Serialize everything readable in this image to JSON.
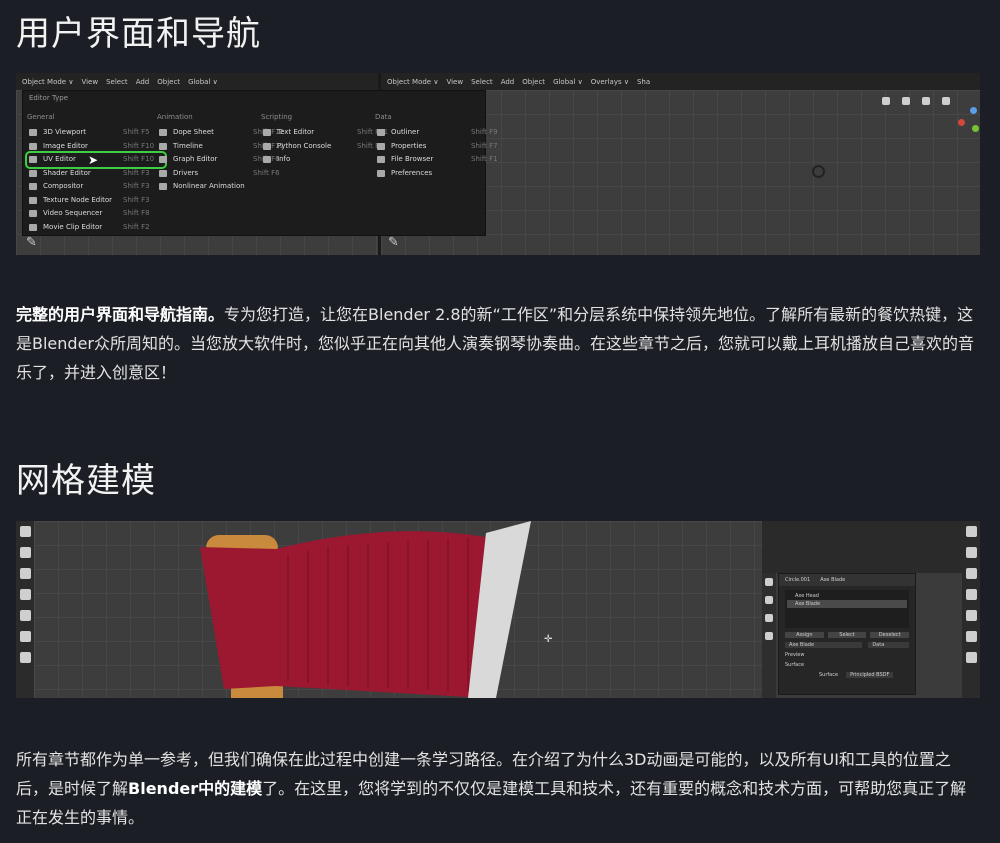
{
  "section1": {
    "title": "用户界面和导航",
    "para_lead": "完整的用户界面和导航指南。",
    "para_rest": "专为您打造，让您在Blender 2.8的新“工作区”和分层系统中保持领先地位。了解所有最新的餐饮热键，这是Blender众所周知的。当您放大软件时，您似乎正在向其他人演奏钢琴协奏曲。在这些章节之后，您就可以戴上耳机播放自己喜欢的音乐了，并进入创意区！"
  },
  "screenshot1": {
    "left_bar": [
      "Object Mode ∨",
      "View",
      "Select",
      "Add",
      "Object",
      "Global ∨"
    ],
    "right_bar": [
      "Object Mode ∨",
      "View",
      "Select",
      "Add",
      "Object",
      "Global ∨",
      "Overlays ∨",
      "Sha"
    ],
    "menu_title": "Editor Type",
    "columns": [
      {
        "header": "General",
        "items": [
          {
            "label": "3D Viewport",
            "shortcut": "Shift F5"
          },
          {
            "label": "Image Editor",
            "shortcut": "Shift F10"
          },
          {
            "label": "UV Editor",
            "shortcut": "Shift F10"
          },
          {
            "label": "Shader Editor",
            "shortcut": "Shift F3"
          },
          {
            "label": "Compositor",
            "shortcut": "Shift F3"
          },
          {
            "label": "Texture Node Editor",
            "shortcut": "Shift F3"
          },
          {
            "label": "Video Sequencer",
            "shortcut": "Shift F8"
          },
          {
            "label": "Movie Clip Editor",
            "shortcut": "Shift F2"
          }
        ]
      },
      {
        "header": "Animation",
        "items": [
          {
            "label": "Dope Sheet",
            "shortcut": "Shift F12"
          },
          {
            "label": "Timeline",
            "shortcut": "Shift F12"
          },
          {
            "label": "Graph Editor",
            "shortcut": "Shift F6"
          },
          {
            "label": "Drivers",
            "shortcut": "Shift F6"
          },
          {
            "label": "Nonlinear Animation",
            "shortcut": ""
          }
        ]
      },
      {
        "header": "Scripting",
        "items": [
          {
            "label": "Text Editor",
            "shortcut": "Shift F11"
          },
          {
            "label": "Python Console",
            "shortcut": "Shift F4"
          },
          {
            "label": "Info",
            "shortcut": ""
          }
        ]
      },
      {
        "header": "Data",
        "items": [
          {
            "label": "Outliner",
            "shortcut": "Shift F9"
          },
          {
            "label": "Properties",
            "shortcut": "Shift F7"
          },
          {
            "label": "File Browser",
            "shortcut": "Shift F1"
          },
          {
            "label": "Preferences",
            "shortcut": ""
          }
        ]
      }
    ],
    "highlight_color": "#3ecf3e"
  },
  "section2": {
    "title": "网格建模",
    "para_a": "所有章节都作为单一参考，但我们确保在此过程中创建一条学习路径。在介绍了为什么3D动画是可能的，以及所有UI和工具的位置之后，是时候了解",
    "para_bold": "Blender中的建模",
    "para_b": "了。在这里，您将学到的不仅仅是建模工具和技术，还有重要的概念和技术方面，可帮助您真正了解正在发生的事情。"
  },
  "screenshot2": {
    "panel_header": [
      "Circle.001",
      "Axe Blade"
    ],
    "panel_list": [
      "Axe Head",
      "Axe Blade"
    ],
    "panel_buttons": [
      "Assign",
      "Select",
      "Deselect"
    ],
    "panel_material": "Axe Blade",
    "panel_data": "Data",
    "panel_sections": [
      "Preview",
      "Surface"
    ],
    "panel_surface_label": "Surface",
    "panel_surface_value": "Principled BSDF",
    "blade_color": "#9c1830",
    "handle_color": "#c98a3e"
  }
}
